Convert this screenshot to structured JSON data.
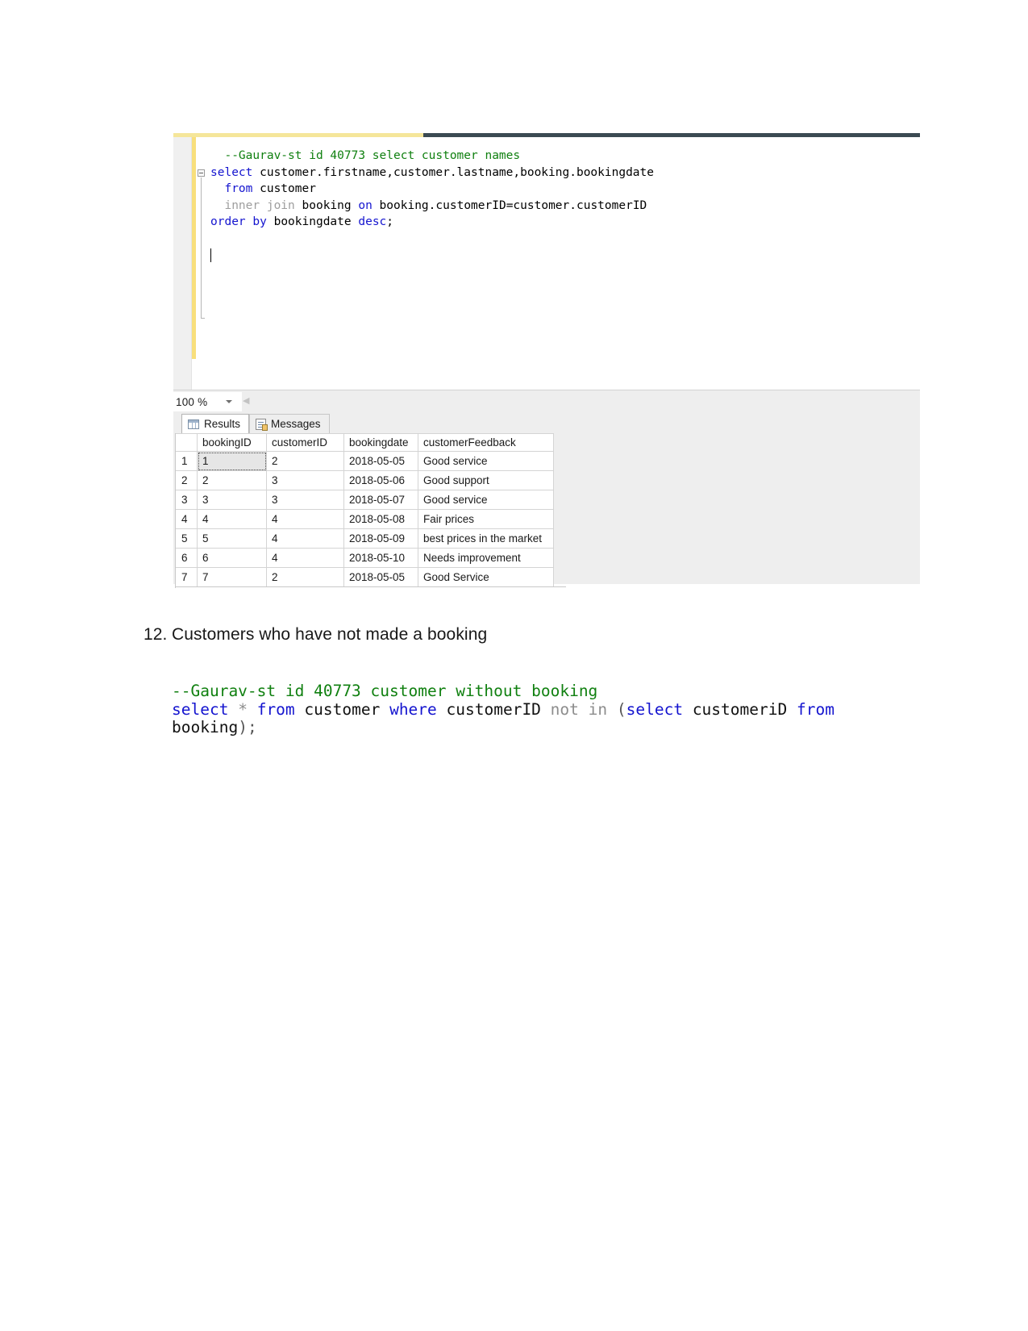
{
  "editor": {
    "zoom_level": "100 %",
    "lines": [
      {
        "tokens": [
          {
            "t": "  ",
            "c": "plain"
          },
          {
            "t": "--Gaurav-st id 40773 select customer names",
            "c": "cmt"
          }
        ]
      },
      {
        "tokens": [
          {
            "t": "select",
            "c": "kw"
          },
          {
            "t": " customer.firstname,customer.lastname,booking.bookingdate",
            "c": "plain"
          }
        ]
      },
      {
        "tokens": [
          {
            "t": "  ",
            "c": "plain"
          },
          {
            "t": "from",
            "c": "kw"
          },
          {
            "t": " customer",
            "c": "plain"
          }
        ]
      },
      {
        "tokens": [
          {
            "t": "  ",
            "c": "plain"
          },
          {
            "t": "inner join",
            "c": "gry"
          },
          {
            "t": " booking ",
            "c": "plain"
          },
          {
            "t": "on",
            "c": "kw"
          },
          {
            "t": " booking.customerID=customer.customerID",
            "c": "plain"
          }
        ]
      },
      {
        "tokens": [
          {
            "t": "order",
            "c": "kw"
          },
          {
            "t": " ",
            "c": "plain"
          },
          {
            "t": "by",
            "c": "kw"
          },
          {
            "t": " bookingdate ",
            "c": "plain"
          },
          {
            "t": "desc",
            "c": "kw"
          },
          {
            "t": ";",
            "c": "plain"
          }
        ]
      }
    ]
  },
  "results_pane": {
    "tabs": [
      {
        "label": "Results",
        "icon": "grid-icon",
        "active": true
      },
      {
        "label": "Messages",
        "icon": "messages-icon",
        "active": false
      }
    ],
    "grid": {
      "row_header_label": "",
      "columns": [
        "bookingID",
        "customerID",
        "bookingdate",
        "customerFeedback"
      ],
      "rows": [
        {
          "n": "1",
          "cells": [
            "1",
            "2",
            "2018-05-05",
            "Good service"
          ]
        },
        {
          "n": "2",
          "cells": [
            "2",
            "3",
            "2018-05-06",
            "Good support"
          ]
        },
        {
          "n": "3",
          "cells": [
            "3",
            "3",
            "2018-05-07",
            "Good service"
          ]
        },
        {
          "n": "4",
          "cells": [
            "4",
            "4",
            "2018-05-08",
            "Fair prices"
          ]
        },
        {
          "n": "5",
          "cells": [
            "5",
            "4",
            "2018-05-09",
            "best prices in the market"
          ]
        },
        {
          "n": "6",
          "cells": [
            "6",
            "4",
            "2018-05-10",
            "Needs improvement"
          ]
        },
        {
          "n": "7",
          "cells": [
            "7",
            "2",
            "2018-05-05",
            "Good Service"
          ]
        }
      ],
      "selected_cell": {
        "row": 0,
        "col": 0
      }
    }
  },
  "document": {
    "heading": {
      "number": "12.",
      "text": "Customers who have not made a booking"
    },
    "sql_block": [
      {
        "t": "--Gaurav-st id 40773 customer without booking",
        "c": "cmt"
      },
      {
        "t": "\n",
        "c": "plain"
      },
      {
        "t": "select",
        "c": "kw"
      },
      {
        "t": " ",
        "c": "plain"
      },
      {
        "t": "*",
        "c": "gry"
      },
      {
        "t": " ",
        "c": "plain"
      },
      {
        "t": "from",
        "c": "kw"
      },
      {
        "t": " customer ",
        "c": "plain"
      },
      {
        "t": "where",
        "c": "kw"
      },
      {
        "t": " customerID ",
        "c": "plain"
      },
      {
        "t": "not in",
        "c": "gry"
      },
      {
        "t": " ",
        "c": "plain"
      },
      {
        "t": "(",
        "c": "pun"
      },
      {
        "t": "select",
        "c": "kw"
      },
      {
        "t": " customeriD ",
        "c": "plain"
      },
      {
        "t": "from",
        "c": "kw"
      },
      {
        "t": " booking",
        "c": "plain"
      },
      {
        "t": ")",
        "c": "pun"
      },
      {
        "t": ";",
        "c": "pun"
      }
    ]
  },
  "colors": {
    "keyword": "#1414cf",
    "comment": "#108010",
    "grey_token": "#9e9e9e",
    "change_bar": "#f8df7c",
    "editor_top_accent": "#3b4a52"
  }
}
